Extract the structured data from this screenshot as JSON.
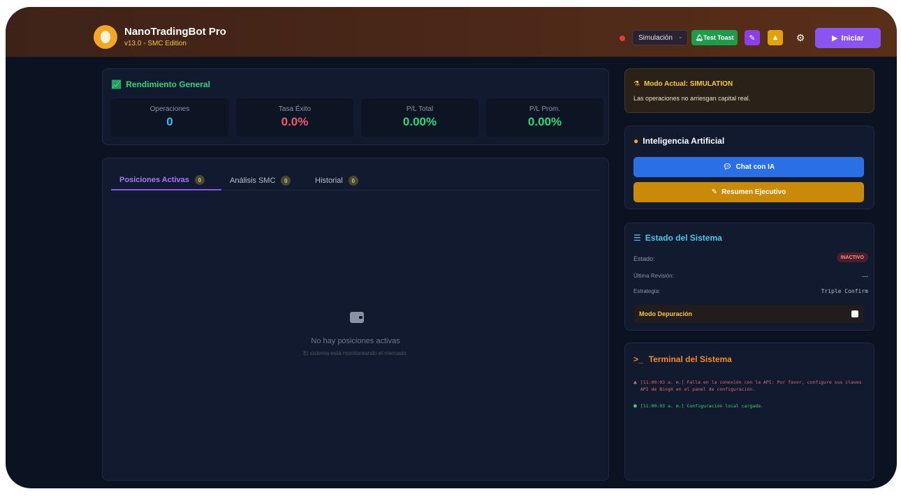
{
  "header": {
    "app_title": "NanoTradingBot Pro",
    "app_version": "v13.0 - SMC Edition",
    "mode_select_value": "Simulación",
    "test_button_label": "Test Toast",
    "start_button_label": "Iniciar",
    "status_dot_color": "#e23b3b"
  },
  "performance": {
    "title": "Rendimiento General",
    "stats": [
      {
        "label": "Operaciones",
        "value": "0",
        "color": "#3fb7f0"
      },
      {
        "label": "Tasa Éxito",
        "value": "0.0%",
        "color": "#f05a6b"
      },
      {
        "label": "P/L Total",
        "value": "0.00%",
        "color": "#2fd67a"
      },
      {
        "label": "P/L Prom.",
        "value": "0.00%",
        "color": "#2fd67a"
      }
    ]
  },
  "positions": {
    "tabs": [
      {
        "label": "Posiciones Activas",
        "count": "0"
      },
      {
        "label": "Análisis SMC",
        "count": "0"
      },
      {
        "label": "Historial",
        "count": "0"
      }
    ],
    "empty_title": "No hay posiciones activas",
    "empty_subtitle": "El sistema está monitoreando el mercado."
  },
  "mode_card": {
    "title": "Modo Actual: SIMULATION",
    "description": "Las operaciones no arriesgan capital real."
  },
  "ai": {
    "title": "Inteligencia Artificial",
    "chat_label": "Chat con IA",
    "summary_label": "Resumen Ejecutivo"
  },
  "system": {
    "title": "Estado del Sistema",
    "state_label": "Estado:",
    "state_value": "INACTIVO",
    "last_review_label": "Última Revisión:",
    "last_review_value": "---",
    "strategy_label": "Estrategia:",
    "strategy_value": "Triple Confirm",
    "debug_label": "Modo Depuración"
  },
  "terminal": {
    "title": "Terminal del Sistema",
    "logs": [
      {
        "type": "error",
        "text": "[11:00:03 a. m.] Falla en la conexión con la API: Por favor, configure sus claves API de BingX en el panel de configuración."
      },
      {
        "type": "success",
        "text": "[11:00:03 a. m.] Configuración local cargada."
      }
    ]
  }
}
